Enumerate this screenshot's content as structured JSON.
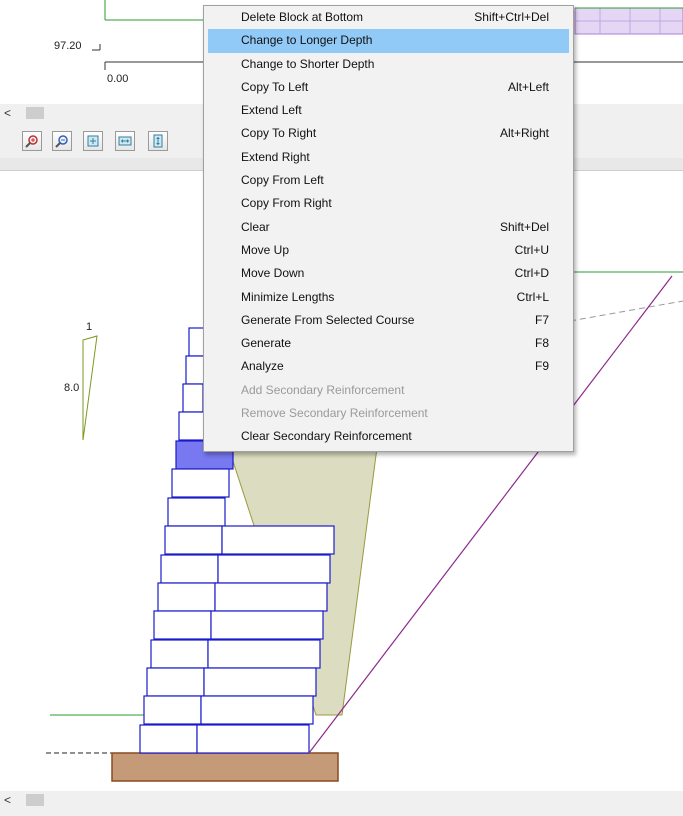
{
  "top_chart": {
    "y_label": "97.20",
    "x_label": "0.00"
  },
  "toolbar": {
    "buttons": [
      "zoom-in-icon",
      "zoom-out-icon",
      "zoom-fit-icon",
      "zoom-horizontal-icon",
      "zoom-vertical-icon"
    ]
  },
  "scrollbar": {
    "left_arrow": "<"
  },
  "main": {
    "ratio_top": "1",
    "ratio_side": "8.0"
  },
  "context_menu": {
    "items": [
      {
        "label": "Delete Block at Bottom",
        "shortcut": "Shift+Ctrl+Del",
        "state": "normal"
      },
      {
        "label": "Change to  Longer Depth",
        "shortcut": "",
        "state": "highlighted"
      },
      {
        "label": "Change to Shorter Depth",
        "shortcut": "",
        "state": "normal"
      },
      {
        "label": "Copy To Left",
        "shortcut": "Alt+Left",
        "state": "normal"
      },
      {
        "label": "Extend Left",
        "shortcut": "",
        "state": "normal"
      },
      {
        "label": "Copy To Right",
        "shortcut": "Alt+Right",
        "state": "normal"
      },
      {
        "label": "Extend Right",
        "shortcut": "",
        "state": "normal"
      },
      {
        "label": "Copy From Left",
        "shortcut": "",
        "state": "normal"
      },
      {
        "label": "Copy From Right",
        "shortcut": "",
        "state": "normal"
      },
      {
        "label": "Clear",
        "shortcut": "Shift+Del",
        "state": "normal"
      },
      {
        "label": "Move Up",
        "shortcut": "Ctrl+U",
        "state": "normal"
      },
      {
        "label": "Move Down",
        "shortcut": "Ctrl+D",
        "state": "normal"
      },
      {
        "label": "Minimize Lengths",
        "shortcut": "Ctrl+L",
        "state": "normal"
      },
      {
        "label": "Generate From Selected Course",
        "shortcut": "F7",
        "state": "normal"
      },
      {
        "label": "Generate",
        "shortcut": "F8",
        "state": "normal"
      },
      {
        "label": "Analyze",
        "shortcut": "F9",
        "state": "normal"
      },
      {
        "label": "Add Secondary Reinforcement",
        "shortcut": "",
        "state": "disabled"
      },
      {
        "label": "Remove Secondary Reinforcement",
        "shortcut": "",
        "state": "disabled"
      },
      {
        "label": "Clear Secondary Reinforcement",
        "shortcut": "",
        "state": "normal"
      }
    ]
  },
  "colors": {
    "block_outline": "#1a1acc",
    "block_selected": "#7878f0",
    "reinforced_zone": "#dcdcc0",
    "foundation": "#c49a78",
    "slip_line": "#8b2a8b",
    "ground_line": "#2e9a2e",
    "menu_highlight": "#91c9f7"
  }
}
